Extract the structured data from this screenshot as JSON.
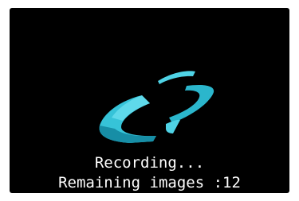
{
  "status": {
    "recording_label": "Recording...",
    "remaining_label": "Remaining images :12"
  },
  "progress_ring": {
    "icon": "recording-progress-ring-icon"
  },
  "colors": {
    "background": "#000000",
    "text": "#ffffff",
    "ring_light": "#4fd3e6",
    "ring_mid": "#2bb6cc",
    "ring_dark": "#178ea6"
  }
}
